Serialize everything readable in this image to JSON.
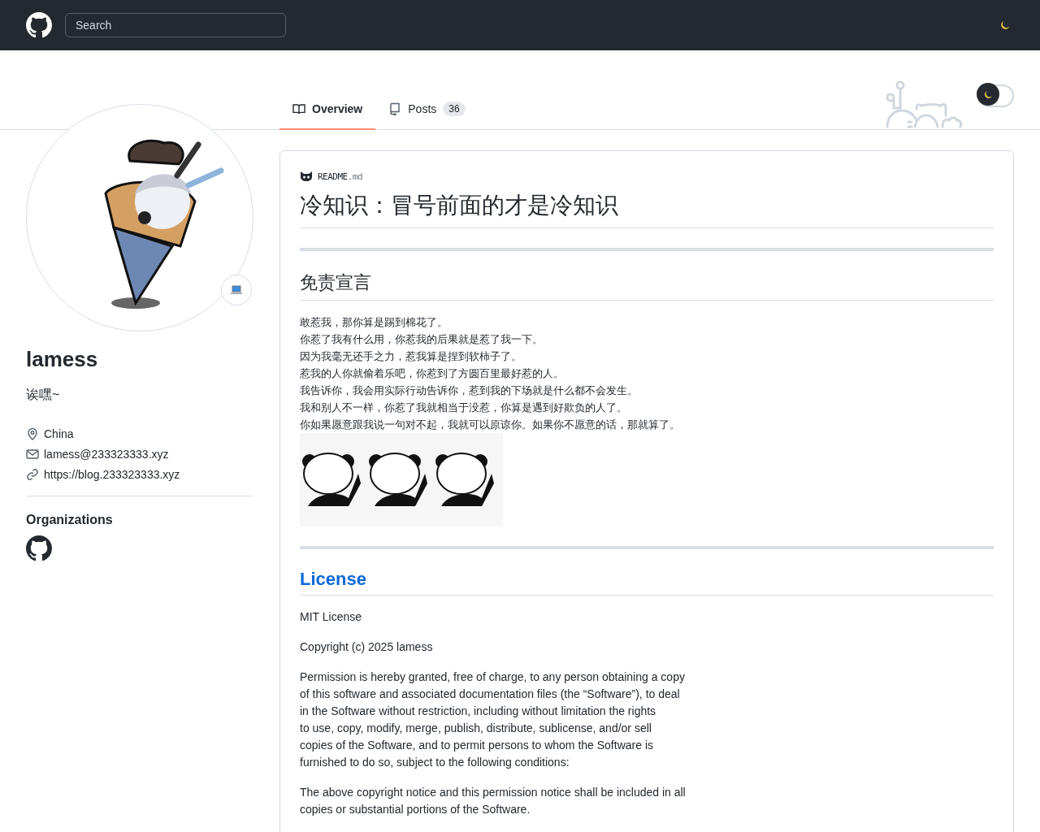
{
  "header": {
    "search": {
      "placeholder": "Search"
    }
  },
  "tabs": [
    {
      "label": "Overview",
      "selected": true,
      "kind": "book"
    },
    {
      "label": "Posts",
      "selected": false,
      "kind": "repo",
      "count": "36"
    }
  ],
  "theme_toggle": {
    "on": false
  },
  "profile": {
    "name": "lamess",
    "bio": "诶嘿~",
    "details": [
      {
        "kind": "location",
        "text": "China"
      },
      {
        "kind": "email",
        "text": "lamess@233323333.xyz"
      },
      {
        "kind": "link",
        "text": "https://blog.233323333.xyz"
      }
    ],
    "organizations_title": "Organizations"
  },
  "readme": {
    "file": "README",
    "ext": ".md",
    "title": "冷知识：冒号前面的才是冷知识",
    "sections": [
      {
        "heading": "免责宣言",
        "kind": "plain",
        "paragraphs": [
          "敢惹我，那你算是踢到棉花了。",
          "你惹了我有什么用，你惹我的后果就是惹了我一下。",
          "因为我毫无还手之力，惹我算是捏到软柿子了。",
          "惹我的人你就偷着乐吧，你惹到了方圆百里最好惹的人。",
          "我告诉你，我会用实际行动告诉你，惹到我的下场就是什么都不会发生。",
          "我和别人不一样，你惹了我就相当于没惹，你算是遇到好欺负的人了。",
          "你如果愿意跟我说一句对不起，我就可以原谅你。如果你不愿意的话，那就算了。"
        ],
        "picture": true
      },
      {
        "heading": "License",
        "kind": "link",
        "paragraphs": [
          "MIT License",
          "Copyright (c) 2025 lamess",
          "Permission is hereby granted, free of charge, to any person obtaining a copy\nof this software and associated documentation files (the “Software”), to deal\nin the Software without restriction, including without limitation the rights\nto use, copy, modify, merge, publish, distribute, sublicense, and/or sell\ncopies of the Software, and to permit persons to whom the Software is\nfurnished to do so, subject to the following conditions:",
          "The above copyright notice and this permission notice shall be included in all\ncopies or substantial portions of the Software."
        ]
      }
    ]
  }
}
